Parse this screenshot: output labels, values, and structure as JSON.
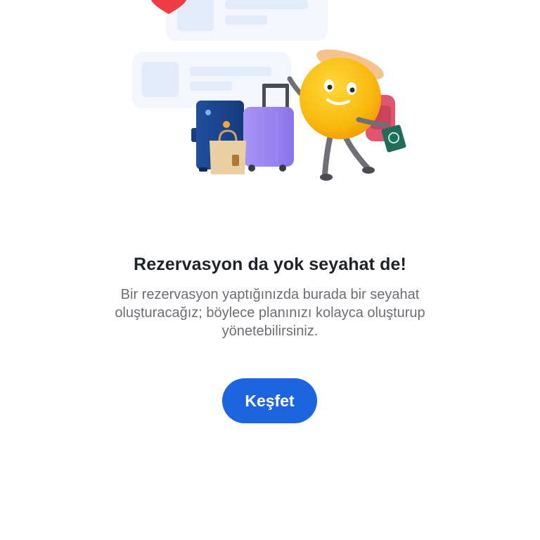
{
  "empty_state": {
    "title": "Rezervasyon da yok seyahat de!",
    "description": "Bir rezervasyon yaptığınızda burada bir seyahat oluşturacağız; böylece planınızı kolayca oluşturup yönetebilirsiniz.",
    "button_label": "Keşfet"
  },
  "colors": {
    "accent": "#1d64e0",
    "title": "#1f2328",
    "description": "#6b6e73"
  },
  "icons": {
    "illustration": "travel-emoji-with-luggage-illustration",
    "heart": "heart-icon"
  }
}
